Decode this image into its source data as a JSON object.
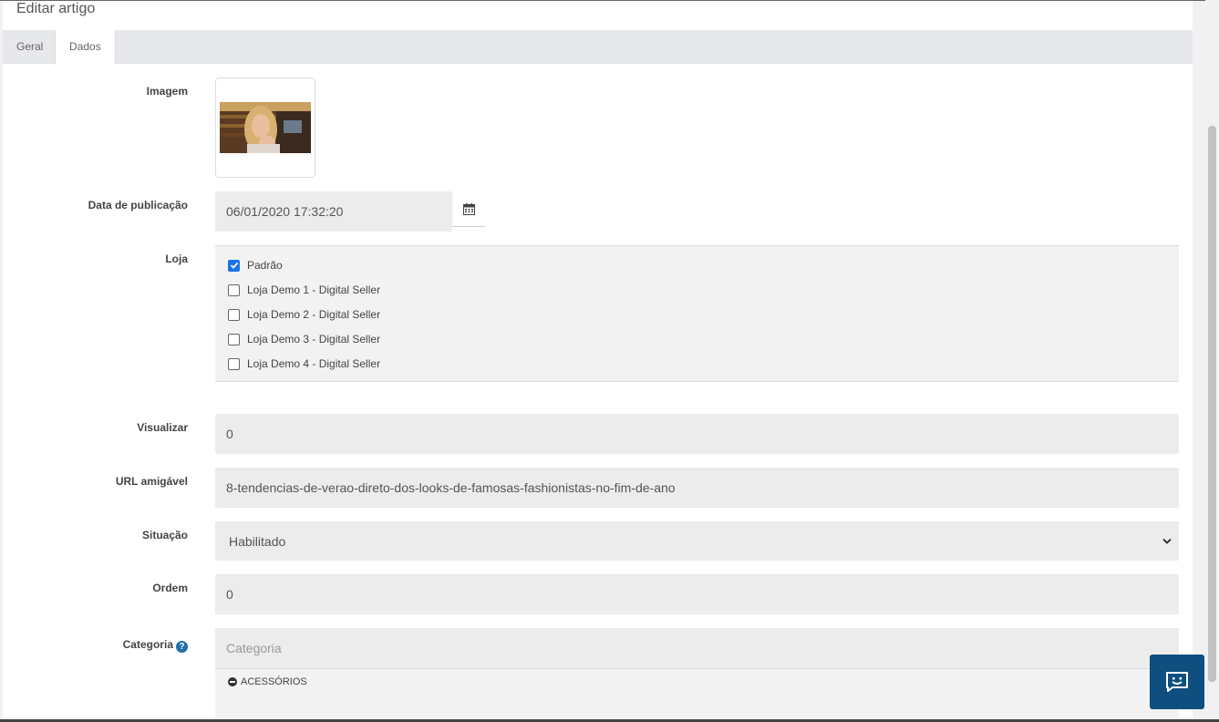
{
  "panel": {
    "title": "Editar artigo"
  },
  "tabs": [
    {
      "label": "Geral"
    },
    {
      "label": "Dados"
    }
  ],
  "form": {
    "image_label": "Imagem",
    "date_label": "Data de publicação",
    "date_value": "06/01/2020 17:32:20",
    "store_label": "Loja",
    "stores": [
      {
        "label": "Padrão",
        "checked": true
      },
      {
        "label": "Loja Demo 1 - Digital Seller",
        "checked": false
      },
      {
        "label": "Loja Demo 2 - Digital Seller",
        "checked": false
      },
      {
        "label": "Loja Demo 3 - Digital Seller",
        "checked": false
      },
      {
        "label": "Loja Demo 4 - Digital Seller",
        "checked": false
      }
    ],
    "views_label": "Visualizar",
    "views_value": "0",
    "url_label": "URL amigável",
    "url_value": "8-tendencias-de-verao-direto-dos-looks-de-famosas-fashionistas-no-fim-de-ano",
    "status_label": "Situação",
    "status_value": "Habilitado",
    "order_label": "Ordem",
    "order_value": "0",
    "category_label": "Categoria",
    "category_placeholder": "Categoria",
    "categories": [
      "ACESSÓRIOS"
    ]
  },
  "icons": {
    "calendar": "calendar-icon",
    "chevron": "chevron-down-icon",
    "help": "help-icon",
    "chat": "chat-icon",
    "remove": "remove-icon"
  },
  "colors": {
    "accent": "#1a73e8",
    "chat_bg": "#0e4f7f",
    "field_bg": "#ececec"
  }
}
